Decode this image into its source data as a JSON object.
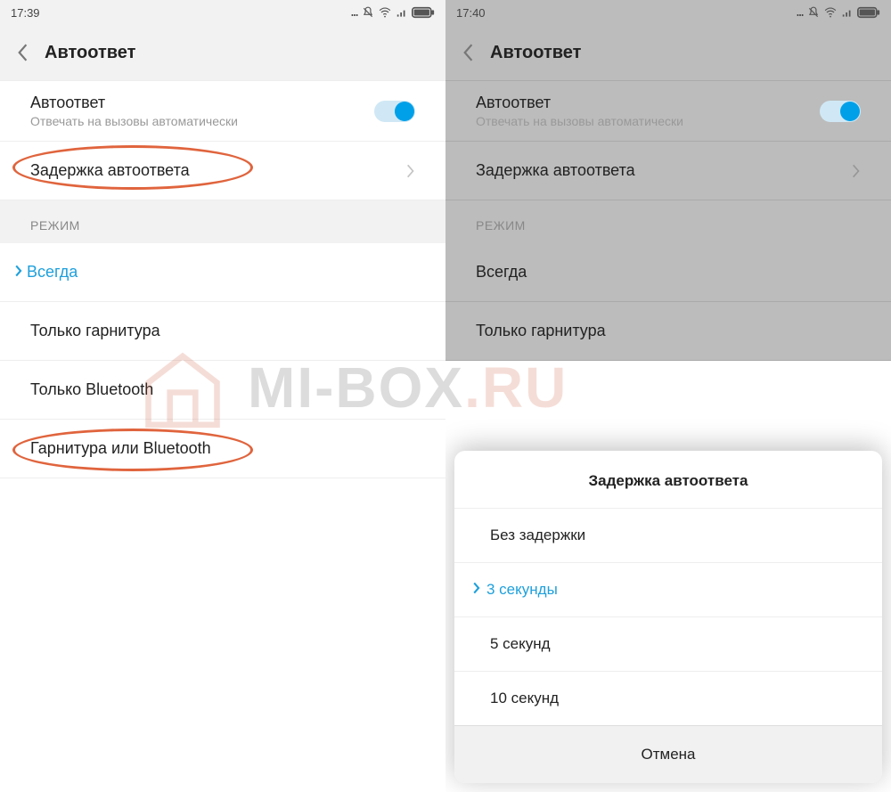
{
  "left": {
    "time": "17:39",
    "pageTitle": "Автоответ",
    "autoAnswer": {
      "title": "Автоответ",
      "subtitle": "Отвечать на вызовы автоматически",
      "enabled": true
    },
    "delayRow": "Задержка автоответа",
    "sectionMode": "РЕЖИМ",
    "modes": [
      "Всегда",
      "Только гарнитура",
      "Только Bluetooth",
      "Гарнитура или Bluetooth"
    ],
    "selectedModeIndex": 0
  },
  "right": {
    "time": "17:40",
    "pageTitle": "Автоответ",
    "autoAnswer": {
      "title": "Автоответ",
      "subtitle": "Отвечать на вызовы автоматически",
      "enabled": true
    },
    "delayRow": "Задержка автоответа",
    "sectionMode": "РЕЖИМ",
    "modes": [
      "Всегда",
      "Только гарнитура"
    ],
    "dialog": {
      "title": "Задержка автоответа",
      "options": [
        "Без задержки",
        "3 секунды",
        "5 секунд",
        "10 секунд"
      ],
      "selectedIndex": 1,
      "cancel": "Отмена"
    }
  },
  "watermark": {
    "prefix": "MI-BOX",
    "suffix": ".RU"
  }
}
